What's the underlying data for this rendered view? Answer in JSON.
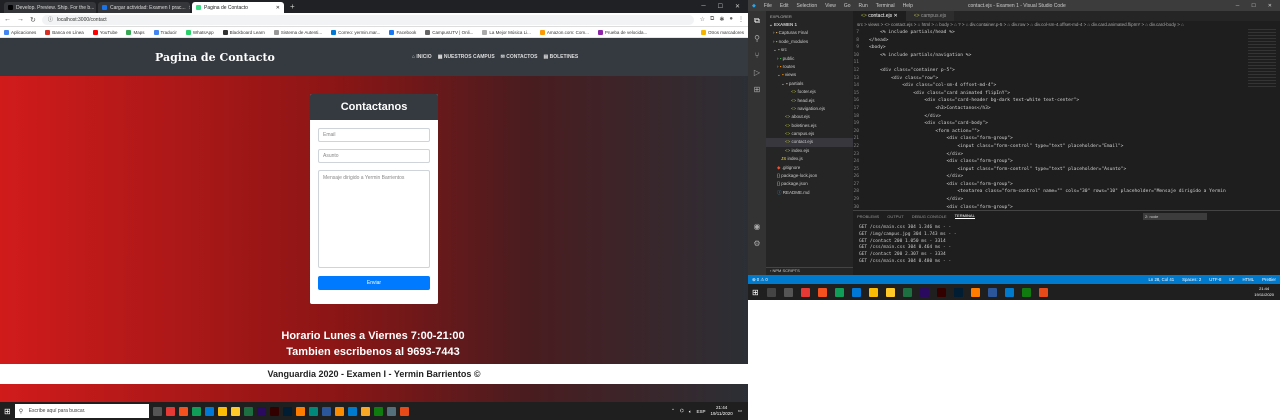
{
  "browser": {
    "tabs": [
      {
        "label": "Develop. Preview. Ship. For the b...",
        "color": "#000000"
      },
      {
        "label": "Cargar actividad: Examen I prac...",
        "color": "#1a73e8"
      },
      {
        "label": "Pagina de Contacto",
        "color": "#3ddc84"
      }
    ],
    "url": "localhost:3000/contact",
    "bookmarks": [
      "Aplicaciones",
      "Banca en Línea",
      "YouTube",
      "Maps",
      "Traducir",
      "WhatsApp",
      "Blackboard Learn",
      "Sistema de Autenti...",
      "Correo: yermin.mar...",
      "Facebook",
      "CampusUTV | Onli...",
      "La Mejor Música Li...",
      "Amazon.com: Com...",
      "Prueba de velocida..."
    ],
    "bookmarks_other": "Otros marcadores"
  },
  "site": {
    "brand": "Pagina de Contacto",
    "nav": [
      "INICIO",
      "NUESTROS CAMPUS",
      "CONTACTOS",
      "BOLETINES"
    ],
    "card_title": "Contactanos",
    "email_placeholder": "Email",
    "subject_placeholder": "Asunto",
    "message_placeholder": "Mensaje dirigido a Yermin Barrientos",
    "submit_label": "Enviar",
    "hours": "Horario Lunes a Viernes 7:00-21:00",
    "phone": "Tambien escribenos al 9693-7443",
    "footer": "Vanguardia 2020 - Examen I - Yermin Barrientos ©"
  },
  "taskbar": {
    "search_placeholder": "Escribe aquí para buscar.",
    "lang": "ESP",
    "time": "21:44",
    "date": "19/11/2020"
  },
  "vscode": {
    "menu": [
      "File",
      "Edit",
      "Selection",
      "View",
      "Go",
      "Run",
      "Terminal",
      "Help"
    ],
    "title": "contact.ejs - Examen 1 - Visual Studio Code",
    "explorer_header": "EXPLORER",
    "tree": [
      "EXAMEN 1",
      "Capturas Final",
      "node_modules",
      "src",
      "public",
      "routes",
      "views",
      "partials",
      "footer.ejs",
      "head.ejs",
      "navigation.ejs",
      "about.ejs",
      "boletines.ejs",
      "campus.ejs",
      "contact.ejs",
      "index.ejs",
      "index.js",
      ".gitignore",
      "package-lock.json",
      "package.json",
      "README.md"
    ],
    "editor_tabs": [
      "contact.ejs",
      "campus.ejs"
    ],
    "breadcrumb": "src > views > <> contact.ejs > ⌂ html > ⌂ body > ⌂ ? > ⌂ div.container.p-5 > ⌂ div.row > ⌂ div.col-sm-4.offset-md-4 > ⌂ div.card.animated.flipInY > ⌂ div.card-body > ⌂",
    "code": [
      {
        "n": "7",
        "t": "    <% include partials/head %>"
      },
      {
        "n": "8",
        "t": "</head>"
      },
      {
        "n": "9",
        "t": "<body>"
      },
      {
        "n": "10",
        "t": "    <% include partials/navigation %>"
      },
      {
        "n": "11",
        "t": ""
      },
      {
        "n": "12",
        "t": "    <div class=\"container p-5\">"
      },
      {
        "n": "13",
        "t": "        <div class=\"row\">"
      },
      {
        "n": "14",
        "t": "            <div class=\"col-sm-4 offset-md-4\">"
      },
      {
        "n": "15",
        "t": "                <div class=\"card animated flipInY\">"
      },
      {
        "n": "16",
        "t": "                    <div class=\"card-header bg-dark text-white text-center\">"
      },
      {
        "n": "17",
        "t": "                        <h3>Contactanos</h3>"
      },
      {
        "n": "18",
        "t": "                    </div>"
      },
      {
        "n": "19",
        "t": "                    <div class=\"card-body\">"
      },
      {
        "n": "20",
        "t": "                        <form action=\"\">"
      },
      {
        "n": "21",
        "t": "                            <div class=\"form-group\">"
      },
      {
        "n": "22",
        "t": "                                <input class=\"form-control\" type=\"text\" placeholder=\"Email\">"
      },
      {
        "n": "23",
        "t": "                            </div>"
      },
      {
        "n": "24",
        "t": "                            <div class=\"form-group\">"
      },
      {
        "n": "25",
        "t": "                                <input class=\"form-control\" type=\"text\" placeholder=\"Asunto\">"
      },
      {
        "n": "26",
        "t": "                            </div>"
      },
      {
        "n": "27",
        "t": "                            <div class=\"form-group\">"
      },
      {
        "n": "28",
        "t": "                                <textarea class=\"form-control\" name=\"\" cols=\"30\" rows=\"10\" placeholder=\"Mensaje dirigido a Yermin"
      },
      {
        "n": "29",
        "t": "                            </div>"
      },
      {
        "n": "30",
        "t": "                            <div class=\"form-group\">"
      }
    ],
    "panel_tabs": [
      "PROBLEMS",
      "OUTPUT",
      "DEBUG CONSOLE",
      "TERMINAL"
    ],
    "terminal_select": "2: node",
    "terminal": [
      "GET /css/main.css 304 1.346 ms - -",
      "GET /img/campus.jpg 304 1.743 ms - -",
      "GET /contact 200 1.050 ms - 3314",
      "GET /css/main.css 304 0.464 ms - -",
      "GET /contact 200 2.307 ms - 3334",
      "GET /css/main.css 304 0.480 ms - -"
    ],
    "npm_scripts": "NPM SCRIPTS",
    "status_left": "⊗ 0 ⚠ 0",
    "status_right": [
      "Ln 28, Col 41",
      "Spaces: 2",
      "UTF-8",
      "LF",
      "HTML",
      "Prettier"
    ],
    "time": "21:44",
    "date": "19/11/2020"
  }
}
